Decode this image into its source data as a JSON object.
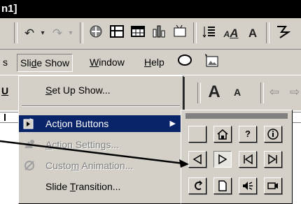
{
  "window": {
    "title_fragment": "n1]"
  },
  "menubar": {
    "items": [
      {
        "label": "Slide Show",
        "underline_index": 3
      },
      {
        "label": "Window",
        "underline_index": 0
      },
      {
        "label": "Help",
        "underline_index": 0
      }
    ]
  },
  "toolbar": {
    "font_big": "A",
    "font_small": "A"
  },
  "slide_show_menu": {
    "items": [
      {
        "label": "Set Up Show...",
        "state": "normal",
        "icon": "none"
      },
      {
        "label": "Action Buttons",
        "state": "highlighted",
        "icon": "action-buttons-icon",
        "has_submenu": true
      },
      {
        "label": "Action Settings...",
        "state": "disabled",
        "icon": "action-settings-icon"
      },
      {
        "label": "Custom Animation...",
        "state": "disabled",
        "icon": "custom-animation-icon"
      },
      {
        "label": "Slide Transition...",
        "state": "normal",
        "icon": "none"
      }
    ]
  },
  "action_buttons_submenu": {
    "rows": [
      [
        "custom-blank",
        "home-icon",
        "help-icon",
        "information-icon"
      ],
      [
        "back-previous-icon",
        "forward-next-icon",
        "beginning-icon",
        "end-icon"
      ],
      [
        "return-icon",
        "document-icon",
        "sound-icon",
        "movie-icon"
      ]
    ],
    "pressed": "forward-next-icon"
  },
  "colors": {
    "highlight": "#0a246a",
    "face": "#d4d0c8",
    "shadow": "#808080"
  }
}
